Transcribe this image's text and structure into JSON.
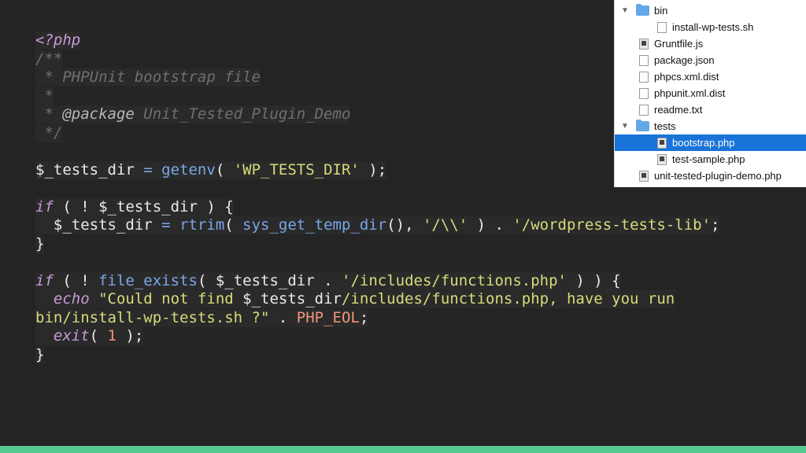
{
  "code": {
    "lines": [
      [
        {
          "t": "<?php",
          "c": "phptag"
        }
      ],
      [
        {
          "t": "/**",
          "c": "comment"
        }
      ],
      [
        {
          "t": " * PHPUnit bootstrap file",
          "c": "comment"
        }
      ],
      [
        {
          "t": " *",
          "c": "comment"
        }
      ],
      [
        {
          "t": " * ",
          "c": "comment"
        },
        {
          "t": "@package",
          "c": "tag"
        },
        {
          "t": " Unit_Tested_Plugin_Demo",
          "c": "comment"
        }
      ],
      [
        {
          "t": " */",
          "c": "comment"
        }
      ],
      [],
      [
        {
          "t": "$_tests_dir",
          "c": "var"
        },
        {
          "t": " = ",
          "c": "op"
        },
        {
          "t": "getenv",
          "c": "fn"
        },
        {
          "t": "( ",
          "c": "punc"
        },
        {
          "t": "'WP_TESTS_DIR'",
          "c": "str"
        },
        {
          "t": " );",
          "c": "punc"
        }
      ],
      [],
      [
        {
          "t": "if",
          "c": "kw"
        },
        {
          "t": " ( ! ",
          "c": "punc"
        },
        {
          "t": "$_tests_dir",
          "c": "var"
        },
        {
          "t": " ) {",
          "c": "punc"
        }
      ],
      [
        {
          "t": "  ",
          "c": "punc"
        },
        {
          "t": "$_tests_dir",
          "c": "var"
        },
        {
          "t": " = ",
          "c": "op"
        },
        {
          "t": "rtrim",
          "c": "fn"
        },
        {
          "t": "( ",
          "c": "punc"
        },
        {
          "t": "sys_get_temp_dir",
          "c": "fn"
        },
        {
          "t": "(), ",
          "c": "punc"
        },
        {
          "t": "'/\\\\'",
          "c": "str"
        },
        {
          "t": " ) . ",
          "c": "punc"
        },
        {
          "t": "'/wordpress-tests-lib'",
          "c": "str"
        },
        {
          "t": ";",
          "c": "punc"
        }
      ],
      [
        {
          "t": "}",
          "c": "punc"
        }
      ],
      [],
      [
        {
          "t": "if",
          "c": "kw"
        },
        {
          "t": " ( ! ",
          "c": "punc"
        },
        {
          "t": "file_exists",
          "c": "fn"
        },
        {
          "t": "( ",
          "c": "punc"
        },
        {
          "t": "$_tests_dir",
          "c": "var"
        },
        {
          "t": " . ",
          "c": "punc"
        },
        {
          "t": "'/includes/functions.php'",
          "c": "str"
        },
        {
          "t": " ) ) {",
          "c": "punc"
        }
      ],
      [
        {
          "t": "  ",
          "c": "punc"
        },
        {
          "t": "echo",
          "c": "kw"
        },
        {
          "t": " ",
          "c": "punc"
        },
        {
          "t": "\"Could not find ",
          "c": "str"
        },
        {
          "t": "$_tests_dir",
          "c": "var"
        },
        {
          "t": "/includes/functions.php, have you run",
          "c": "str"
        }
      ],
      [
        {
          "t": "bin/install-wp-tests.sh ?\"",
          "c": "str"
        },
        {
          "t": " . ",
          "c": "punc"
        },
        {
          "t": "PHP_EOL",
          "c": "const"
        },
        {
          "t": ";",
          "c": "punc"
        }
      ],
      [
        {
          "t": "  ",
          "c": "punc"
        },
        {
          "t": "exit",
          "c": "kw"
        },
        {
          "t": "( ",
          "c": "punc"
        },
        {
          "t": "1",
          "c": "num"
        },
        {
          "t": " );",
          "c": "punc"
        }
      ],
      [
        {
          "t": "}",
          "c": "punc"
        }
      ]
    ]
  },
  "file_tree": {
    "rows": [
      {
        "label": "bin",
        "type": "folder",
        "depth": 0,
        "expanded": true,
        "selected": false,
        "icon": "folder-icon"
      },
      {
        "label": "install-wp-tests.sh",
        "type": "file",
        "depth": 1,
        "selected": false,
        "icon": "file-icon"
      },
      {
        "label": "Gruntfile.js",
        "type": "file-dark",
        "depth": 0,
        "selected": false,
        "icon": "script-file-icon"
      },
      {
        "label": "package.json",
        "type": "file",
        "depth": 0,
        "selected": false,
        "icon": "file-icon"
      },
      {
        "label": "phpcs.xml.dist",
        "type": "file",
        "depth": 0,
        "selected": false,
        "icon": "file-icon"
      },
      {
        "label": "phpunit.xml.dist",
        "type": "file",
        "depth": 0,
        "selected": false,
        "icon": "file-icon"
      },
      {
        "label": "readme.txt",
        "type": "file",
        "depth": 0,
        "selected": false,
        "icon": "file-icon"
      },
      {
        "label": "tests",
        "type": "folder",
        "depth": 0,
        "expanded": true,
        "selected": false,
        "icon": "folder-icon"
      },
      {
        "label": "bootstrap.php",
        "type": "file-dark",
        "depth": 1,
        "selected": true,
        "icon": "script-file-icon"
      },
      {
        "label": "test-sample.php",
        "type": "file-dark",
        "depth": 1,
        "selected": false,
        "icon": "script-file-icon"
      },
      {
        "label": "unit-tested-plugin-demo.php",
        "type": "file-dark",
        "depth": 0,
        "selected": false,
        "icon": "script-file-icon"
      }
    ],
    "disclosure_glyph": "▼"
  },
  "colors": {
    "background": "#242424",
    "accent_bar": "#55c88f",
    "selection": "#1a73d9"
  }
}
